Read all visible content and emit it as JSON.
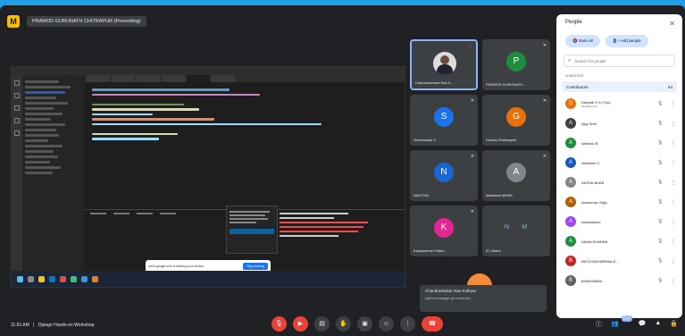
{
  "meeting": {
    "presenter_title": "PRAMOD GURUNATH CHITRAPUR (Presenting)",
    "time": "11:51 AM",
    "separator": "|",
    "name": "Django Hands-on Workshop"
  },
  "share_banner": {
    "text": "meet.google.com is sharing your screen.",
    "stop_label": "Stop sharing"
  },
  "tiles": [
    {
      "name": "Chandrashekar Rao K...",
      "initial": "",
      "color": "",
      "photo": true
    },
    {
      "name": "PRAMOD GURUNATH ...",
      "initial": "P",
      "color": "#1e8e3e"
    },
    {
      "name": "Shrishankar C",
      "initial": "S",
      "color": "#1a73e8"
    },
    {
      "name": "Gowda Thathreyah",
      "initial": "G",
      "color": "#e8710a"
    },
    {
      "name": "NAVITHA",
      "initial": "N",
      "color": "#1967d2"
    },
    {
      "name": "Abhilasha BHAR",
      "initial": "A",
      "color": "#80868b"
    },
    {
      "name": "Kaviyashree Puttan",
      "initial": "K",
      "color": "#e52592"
    },
    {
      "name": "57 others",
      "initial": "",
      "color": ""
    }
  ],
  "others_initials": [
    "N",
    "M"
  ],
  "pinned_self": {
    "name": "Chandrashekar Rao Kuthyar",
    "subtitle": "python manage.py runserver"
  },
  "people_panel": {
    "title": "People",
    "add_people": "Add people",
    "mute_all": "Mute all",
    "search_placeholder": "Search for people",
    "section": "IN MEETING",
    "contributors_label": "Contributors",
    "contributors_count": "64",
    "participants": [
      {
        "name": "Deepak H G (You)",
        "sub": "Meeting host",
        "initial": "D",
        "color": "#e8710a"
      },
      {
        "name": "Ajay Sree",
        "sub": "",
        "initial": "A",
        "color": "#3c4043"
      },
      {
        "name": "Abhinav B",
        "sub": "",
        "initial": "A",
        "color": "#1e8e3e"
      },
      {
        "name": "Abhishek C",
        "sub": "",
        "initial": "A",
        "color": "#185abc"
      },
      {
        "name": "AKSHA BHAR",
        "sub": "",
        "initial": "A",
        "color": "#80868b"
      },
      {
        "name": "Anukumar Gejju",
        "sub": "",
        "initial": "A",
        "color": "#b06000"
      },
      {
        "name": "Ashwinkumr",
        "sub": "",
        "initial": "A",
        "color": "#a142f4"
      },
      {
        "name": "AMAN KHANNA",
        "sub": "",
        "initial": "A",
        "color": "#1e8e3e"
      },
      {
        "name": "BATCHADHARWALE...",
        "sub": "",
        "initial": "B",
        "color": "#c5221f"
      },
      {
        "name": "BHARAMMA",
        "sub": "",
        "initial": "B",
        "color": "#5f6368"
      }
    ]
  },
  "icons": {
    "mic": "microphone-icon",
    "more": "more-vert-icon",
    "close": "close-icon"
  }
}
